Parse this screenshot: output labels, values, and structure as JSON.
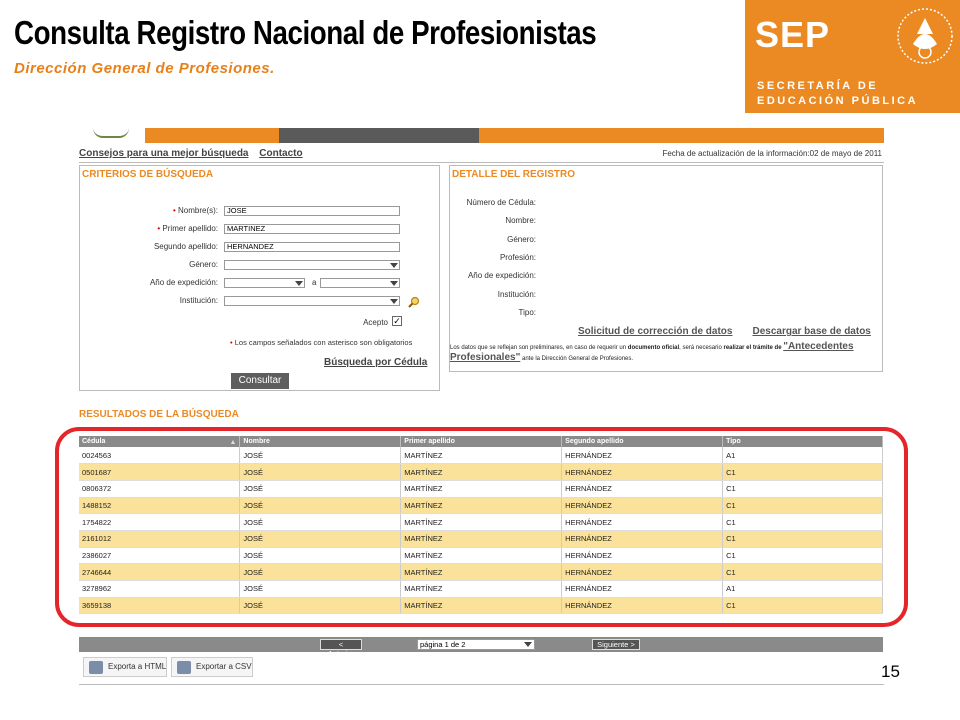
{
  "slide": {
    "title": "Consulta Registro Nacional de Profesionistas",
    "subtitle": "Dirección General de Profesiones.",
    "page_number": "15"
  },
  "logo": {
    "name": "SEP",
    "line1": "SECRETARÍA DE",
    "line2": "EDUCACIÓN PÚBLICA"
  },
  "nav": {
    "tips_link": "Consejos para una mejor búsqueda",
    "contact_link": "Contacto",
    "update_text": "Fecha de actualización de la información:02 de mayo de 2011"
  },
  "criteria": {
    "title": "CRITERIOS DE BÚSQUEDA",
    "nombre_label": "Nombre(s):",
    "nombre_value": "JOSE",
    "primer_label": "Primer apellido:",
    "primer_value": "MARTINEZ",
    "segundo_label": "Segundo apellido:",
    "segundo_value": "HERNANDEZ",
    "genero_label": "Género:",
    "anio_label": "Año de expedición:",
    "anio_sep": "a",
    "institucion_label": "Institución:",
    "acepto_label": "Acepto",
    "acepto_check": "✓",
    "required_marker": "•",
    "required_note": "Los campos señalados con asterisco son obligatorios",
    "busqueda_cedula": "Búsqueda por Cédula",
    "consultar_button": "Consultar"
  },
  "detail": {
    "title": "DETALLE DEL REGISTRO",
    "numero_cedula": "Número de Cédula:",
    "nombre": "Nombre:",
    "genero": "Género:",
    "profesion": "Profesión:",
    "anio": "Año de expedición:",
    "institucion": "Institución:",
    "tipo": "Tipo:",
    "solicitud_link": "Solicitud de corrección de datos",
    "descargar_link": "Descargar base de datos",
    "note_part1": "Los datos que se reflejan son preliminares, en caso de requerir un",
    "note_bold1": "documento oficial",
    "note_part2": ", será necesario",
    "note_bold2": "realizar el trámite de",
    "note_link": "\"Antecedentes Profesionales\"",
    "note_part3": "ante la Dirección General de Profesiones."
  },
  "results": {
    "title": "RESULTADOS DE LA BÚSQUEDA",
    "columns": [
      "Cédula",
      "Nombre",
      "Primer apellido",
      "Segundo apellido",
      "Tipo"
    ],
    "rows": [
      [
        "0024563",
        "JOSÉ",
        "MARTÍNEZ",
        "HERNÁNDEZ",
        "A1"
      ],
      [
        "0501687",
        "JOSÉ",
        "MARTÍNEZ",
        "HERNÁNDEZ",
        "C1"
      ],
      [
        "0806372",
        "JOSÉ",
        "MARTÍNEZ",
        "HERNÁNDEZ",
        "C1"
      ],
      [
        "1488152",
        "JOSÉ",
        "MARTÍNEZ",
        "HERNÁNDEZ",
        "C1"
      ],
      [
        "1754822",
        "JOSÉ",
        "MARTÍNEZ",
        "HERNÁNDEZ",
        "C1"
      ],
      [
        "2161012",
        "JOSÉ",
        "MARTÍNEZ",
        "HERNÁNDEZ",
        "C1"
      ],
      [
        "2386027",
        "JOSÉ",
        "MARTÍNEZ",
        "HERNÁNDEZ",
        "C1"
      ],
      [
        "2746644",
        "JOSÉ",
        "MARTÍNEZ",
        "HERNÁNDEZ",
        "C1"
      ],
      [
        "3278962",
        "JOSÉ",
        "MARTÍNEZ",
        "HERNÁNDEZ",
        "A1"
      ],
      [
        "3659138",
        "JOSÉ",
        "MARTÍNEZ",
        "HERNÁNDEZ",
        "C1"
      ]
    ]
  },
  "pager": {
    "prev": "< Anterior",
    "page_select": "página 1 de 2",
    "next": "Siguiente >"
  },
  "export": {
    "html": "Exporta a HTML",
    "csv": "Exportar a CSV"
  },
  "colors": {
    "accent": "#eb8a23",
    "highlight": "#e4262a",
    "row_alt": "#fbe29a"
  }
}
